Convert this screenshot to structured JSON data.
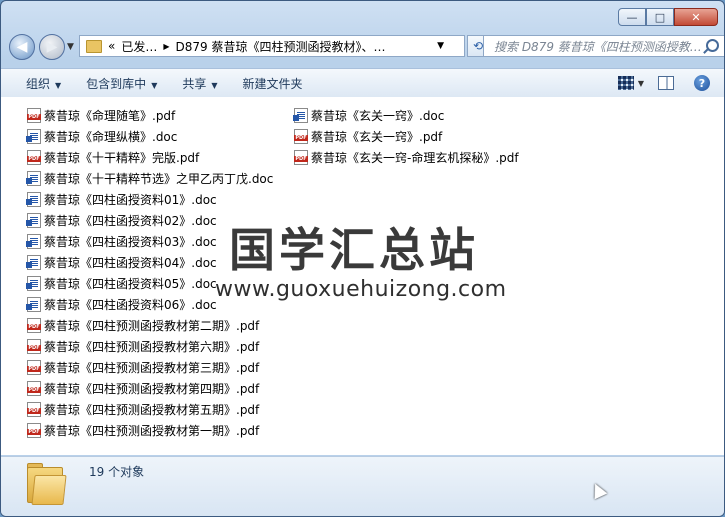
{
  "window": {
    "controls": {
      "minimize": "—",
      "maximize": "□",
      "close": "✕"
    }
  },
  "navigation": {
    "back_icon": "arrow-left",
    "forward_icon": "arrow-right",
    "address_segments": [
      "已发…",
      "D879 蔡昔琼《四柱预测函授教材》、…"
    ],
    "address_prefix": "«",
    "search_placeholder": "搜索 D879 蔡昔琼《四柱预测函授教…"
  },
  "toolbar": {
    "organize": "组织",
    "include_in_library": "包含到库中",
    "share": "共享",
    "new_folder": "新建文件夹"
  },
  "files_left": [
    {
      "name": "蔡昔琼《命理随笔》.pdf",
      "type": "pdf"
    },
    {
      "name": "蔡昔琼《命理纵横》.doc",
      "type": "doc"
    },
    {
      "name": "蔡昔琼《十干精粹》完版.pdf",
      "type": "pdf"
    },
    {
      "name": "蔡昔琼《十干精粹节选》之甲乙丙丁戊.doc",
      "type": "doc"
    },
    {
      "name": "蔡昔琼《四柱函授资料01》.doc",
      "type": "doc"
    },
    {
      "name": "蔡昔琼《四柱函授资料02》.doc",
      "type": "doc"
    },
    {
      "name": "蔡昔琼《四柱函授资料03》.doc",
      "type": "doc"
    },
    {
      "name": "蔡昔琼《四柱函授资料04》.doc",
      "type": "doc"
    },
    {
      "name": "蔡昔琼《四柱函授资料05》.doc",
      "type": "doc"
    },
    {
      "name": "蔡昔琼《四柱函授资料06》.doc",
      "type": "doc"
    },
    {
      "name": "蔡昔琼《四柱预测函授教材第二期》.pdf",
      "type": "pdf"
    },
    {
      "name": "蔡昔琼《四柱预测函授教材第六期》.pdf",
      "type": "pdf"
    },
    {
      "name": "蔡昔琼《四柱预测函授教材第三期》.pdf",
      "type": "pdf"
    },
    {
      "name": "蔡昔琼《四柱预测函授教材第四期》.pdf",
      "type": "pdf"
    },
    {
      "name": "蔡昔琼《四柱预测函授教材第五期》.pdf",
      "type": "pdf"
    },
    {
      "name": "蔡昔琼《四柱预测函授教材第一期》.pdf",
      "type": "pdf"
    }
  ],
  "files_right": [
    {
      "name": "蔡昔琼《玄关一窍》.doc",
      "type": "doc"
    },
    {
      "name": "蔡昔琼《玄关一窍》.pdf",
      "type": "pdf"
    },
    {
      "name": "蔡昔琼《玄关一窍-命理玄机探秘》.pdf",
      "type": "pdf"
    }
  ],
  "watermark": {
    "title": "国学汇总站",
    "url": "www.guoxuehuizong.com"
  },
  "status": {
    "count_text": "19 个对象"
  }
}
